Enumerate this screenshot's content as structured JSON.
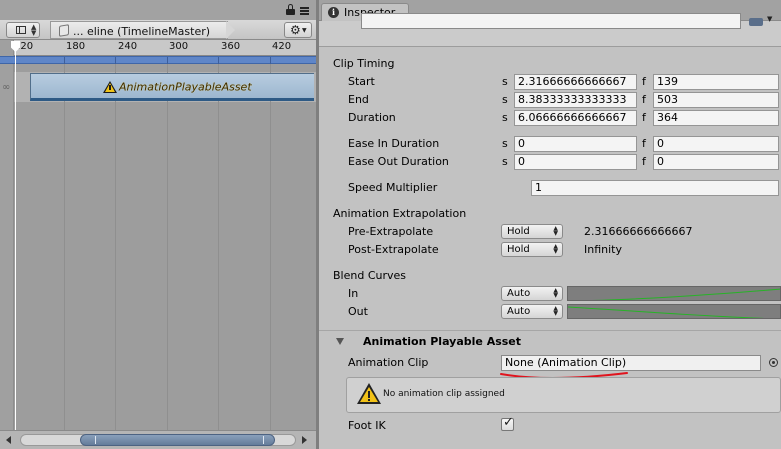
{
  "timeline": {
    "asset_label": "... eline (TimelineMaster)",
    "ruler_ticks": [
      "120",
      "180",
      "240",
      "300",
      "360",
      "420"
    ],
    "clip_label": "AnimationPlayableAsset"
  },
  "inspector": {
    "tab_label": "Inspector",
    "clip_timing": {
      "title": "Clip Timing",
      "rows": [
        {
          "label": "Start",
          "s": "2.31666666666667",
          "f": "139"
        },
        {
          "label": "End",
          "s": "8.38333333333333",
          "f": "503"
        },
        {
          "label": "Duration",
          "s": "6.06666666666667",
          "f": "364"
        }
      ],
      "ease": [
        {
          "label": "Ease In Duration",
          "s": "0",
          "f": "0"
        },
        {
          "label": "Ease Out Duration",
          "s": "0",
          "f": "0"
        }
      ],
      "s_prefix": "s",
      "f_prefix": "f"
    },
    "speed": {
      "label": "Speed Multiplier",
      "value": "1"
    },
    "extrapolation": {
      "title": "Animation Extrapolation",
      "pre": {
        "label": "Pre-Extrapolate",
        "mode": "Hold",
        "value": "2.31666666666667"
      },
      "post": {
        "label": "Post-Extrapolate",
        "mode": "Hold",
        "value": "Infinity"
      }
    },
    "blend": {
      "title": "Blend Curves",
      "in": {
        "label": "In",
        "mode": "Auto"
      },
      "out": {
        "label": "Out",
        "mode": "Auto"
      }
    },
    "playable": {
      "title": "Animation Playable Asset",
      "clip_label": "Animation Clip",
      "clip_value": "None (Animation Clip)",
      "warning": "No animation clip assigned",
      "footik_label": "Foot IK",
      "footik_checked": true
    }
  },
  "colors": {
    "clip_accent": "#2e5a85",
    "ruler_band": "#5f86c8",
    "annotation_red": "#e0141e",
    "curve_line": "#27b327"
  }
}
